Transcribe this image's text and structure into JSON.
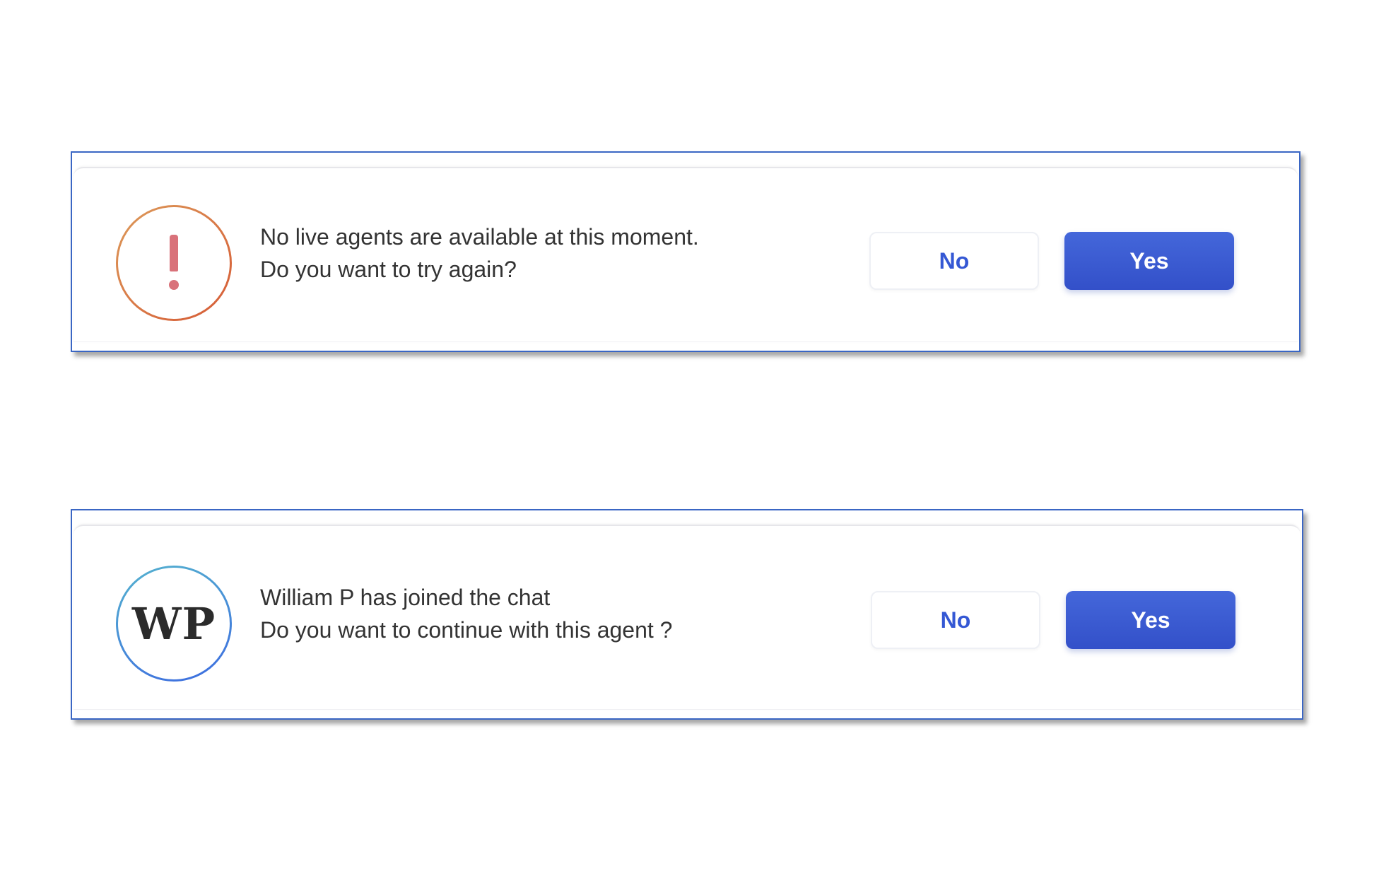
{
  "dialogs": [
    {
      "icon": "exclamation-icon",
      "message_line1": "No live agents are available at this moment.",
      "message_line2": "Do you want to try again?",
      "no_label": "No",
      "yes_label": "Yes"
    },
    {
      "icon": "agent-avatar",
      "avatar_initials": "WP",
      "message_line1": "William P has joined the chat",
      "message_line2": "Do you want to continue with this agent ?",
      "no_label": "No",
      "yes_label": "Yes"
    }
  ],
  "colors": {
    "primary": "#3558d4",
    "dialog_border": "#3a66c4",
    "warning_icon": "#d9727a",
    "warning_ring_start": "#dc9a5a",
    "warning_ring_end": "#d65a35",
    "avatar_ring_start": "#55b3cf",
    "avatar_ring_end": "#3c6be0",
    "text": "#333333"
  }
}
